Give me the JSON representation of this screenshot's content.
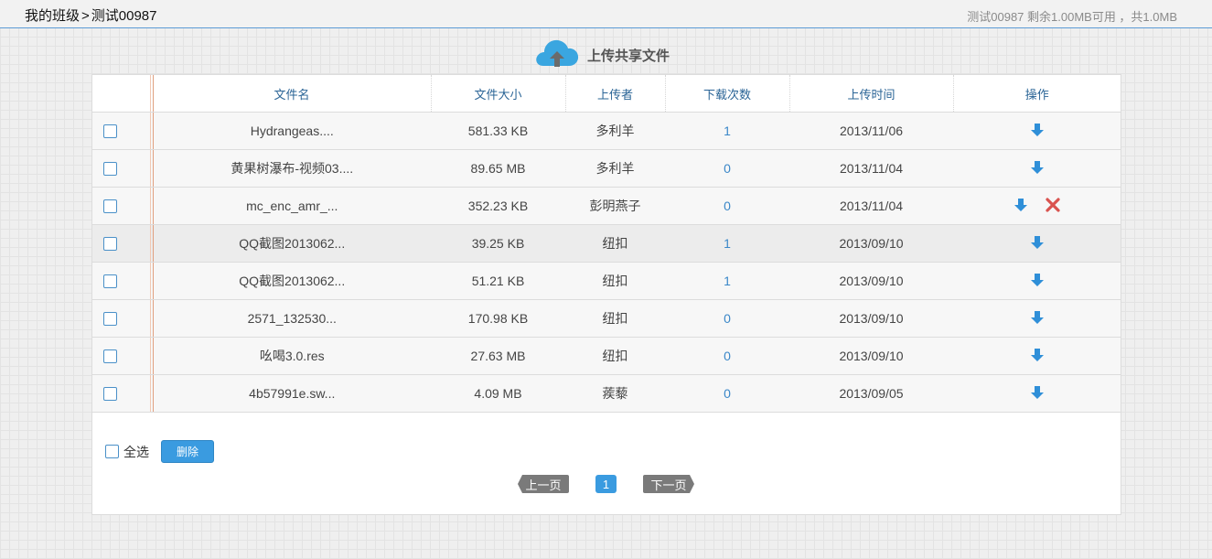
{
  "header": {
    "breadcrumb": [
      "我的班级",
      "测试00987"
    ],
    "separator": ">",
    "quota": "测试00987  剩余1.00MB可用 ，共1.0MB"
  },
  "upload": {
    "label": "上传共享文件",
    "icon": "cloud-upload-icon"
  },
  "table": {
    "headers": [
      "文件名",
      "文件大小",
      "上传者",
      "下载次数",
      "上传时间",
      "操作"
    ],
    "rows": [
      {
        "name": "Hydrangeas....",
        "size": "581.33 KB",
        "uploader": "多利羊",
        "downloads": "1",
        "date": "2013/11/06",
        "can_delete": false
      },
      {
        "name": "黄果树瀑布-视频03....",
        "size": "89.65 MB",
        "uploader": "多利羊",
        "downloads": "0",
        "date": "2013/11/04",
        "can_delete": false
      },
      {
        "name": "mc_enc_amr_...",
        "size": "352.23 KB",
        "uploader": "彭明燕子",
        "downloads": "0",
        "date": "2013/11/04",
        "can_delete": true
      },
      {
        "name": "QQ截图2013062...",
        "size": "39.25 KB",
        "uploader": "纽扣",
        "downloads": "1",
        "date": "2013/09/10",
        "can_delete": false
      },
      {
        "name": "QQ截图2013062...",
        "size": "51.21 KB",
        "uploader": "纽扣",
        "downloads": "1",
        "date": "2013/09/10",
        "can_delete": false
      },
      {
        "name": "2571_132530...",
        "size": "170.98 KB",
        "uploader": "纽扣",
        "downloads": "0",
        "date": "2013/09/10",
        "can_delete": false
      },
      {
        "name": "吆喝3.0.res",
        "size": "27.63 MB",
        "uploader": "纽扣",
        "downloads": "0",
        "date": "2013/09/10",
        "can_delete": false
      },
      {
        "name": "4b57991e.sw...",
        "size": "4.09 MB",
        "uploader": "蒺藜",
        "downloads": "0",
        "date": "2013/09/05",
        "can_delete": false
      }
    ]
  },
  "footer": {
    "select_all": "全选",
    "delete_button": "删除"
  },
  "pagination": {
    "prev": "上一页",
    "current": "1",
    "next": "下一页"
  },
  "colors": {
    "accent": "#3a9be0",
    "link": "#3a87c8",
    "delete": "#d9534f"
  }
}
